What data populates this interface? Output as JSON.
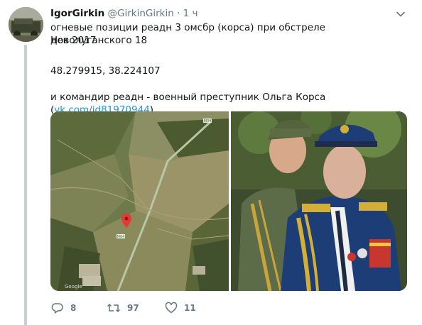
{
  "tweet": {
    "author_name": "IgorGirkin",
    "author_handle": "@GirkinGirkin",
    "separator": "·",
    "time": "1 ч",
    "text_line1": "огневые позиции реадн 3 омсбр (корса) при обстреле Новолуганского 18",
    "text_line2": "дек 2017",
    "coordinates": "48.279915, 38.224107",
    "text_line4_prefix": "и командир реадн - военный преступник Ольга  Корса (",
    "link_text": "vk.com/id81970944",
    "text_line4_suffix": ")",
    "map_label_google": "Google",
    "map_road_label": "M04"
  },
  "actions": {
    "reply_count": "8",
    "retweet_count": "97",
    "like_count": "11"
  },
  "icons": {
    "reply": "reply-icon",
    "retweet": "retweet-icon",
    "like": "heart-icon",
    "caret": "chevron-down-icon",
    "pin": "map-pin-icon"
  },
  "colors": {
    "link": "#1b95e0",
    "secondary_text": "#657786",
    "thread_line": "#c4cfd6",
    "map_pin": "#e53935"
  }
}
